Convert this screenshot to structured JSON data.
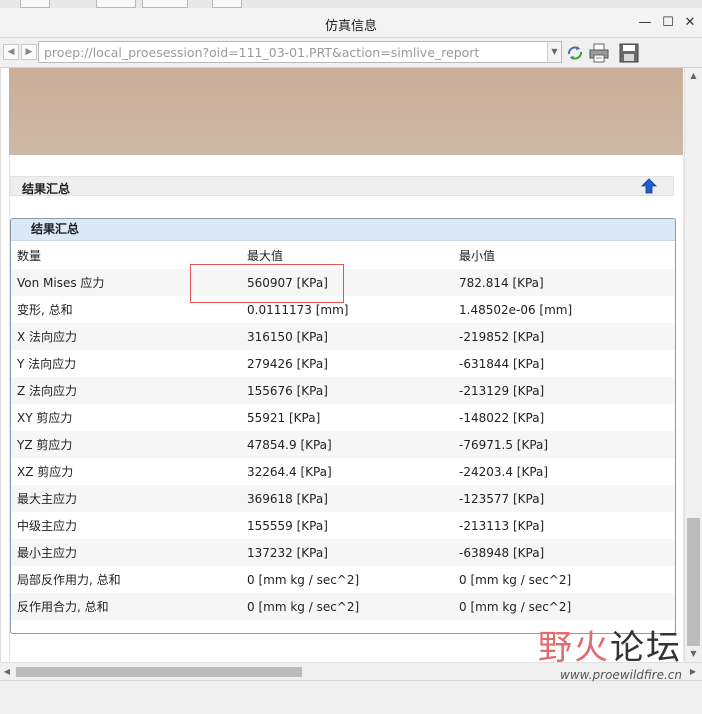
{
  "window": {
    "title": "仿真信息",
    "min_glyph": "—",
    "max_glyph": "☐",
    "close_glyph": "✕"
  },
  "address": {
    "url": "proep://local_proesession?oid=111_03-01.PRT&action=simlive_report"
  },
  "section": {
    "header_label": "结果汇总"
  },
  "panel": {
    "title": "结果汇总",
    "columns": [
      "数量",
      "最大值",
      "最小值"
    ],
    "rows": [
      {
        "quantity": "Von Mises 应力",
        "max": "560907 [KPa]",
        "min": "782.814 [KPa]"
      },
      {
        "quantity": "变形, 总和",
        "max": "0.0111173 [mm]",
        "min": "1.48502e-06 [mm]"
      },
      {
        "quantity": "X 法向应力",
        "max": "316150 [KPa]",
        "min": "-219852 [KPa]"
      },
      {
        "quantity": "Y 法向应力",
        "max": "279426 [KPa]",
        "min": "-631844 [KPa]"
      },
      {
        "quantity": "Z 法向应力",
        "max": "155676 [KPa]",
        "min": "-213129 [KPa]"
      },
      {
        "quantity": "XY 剪应力",
        "max": "55921 [KPa]",
        "min": "-148022 [KPa]"
      },
      {
        "quantity": "YZ 剪应力",
        "max": "47854.9 [KPa]",
        "min": "-76971.5 [KPa]"
      },
      {
        "quantity": "XZ 剪应力",
        "max": "32264.4 [KPa]",
        "min": "-24203.4 [KPa]"
      },
      {
        "quantity": "最大主应力",
        "max": "369618 [KPa]",
        "min": "-123577 [KPa]"
      },
      {
        "quantity": "中级主应力",
        "max": "155559 [KPa]",
        "min": "-213113 [KPa]"
      },
      {
        "quantity": "最小主应力",
        "max": "137232 [KPa]",
        "min": "-638948 [KPa]"
      },
      {
        "quantity": "局部反作用力, 总和",
        "max": "0 [mm kg / sec^2]",
        "min": "0 [mm kg / sec^2]"
      },
      {
        "quantity": "反作用合力, 总和",
        "max": "0 [mm kg / sec^2]",
        "min": "0 [mm kg / sec^2]"
      }
    ]
  },
  "watermark": {
    "brand_red": "野火",
    "brand_dark": "论坛",
    "site": "www.proewildfire.cn"
  },
  "colors": {
    "banner": "#cbb5a1",
    "panel_header": "#dbe8f5",
    "highlight_box": "#e05555",
    "up_arrow": "#1e5fd0"
  },
  "icons": {
    "back": "left-arrow-icon",
    "forward": "right-arrow-icon",
    "refresh": "refresh-icon",
    "print": "printer-icon",
    "save": "floppy-disk-icon",
    "top": "up-arrow-icon"
  }
}
